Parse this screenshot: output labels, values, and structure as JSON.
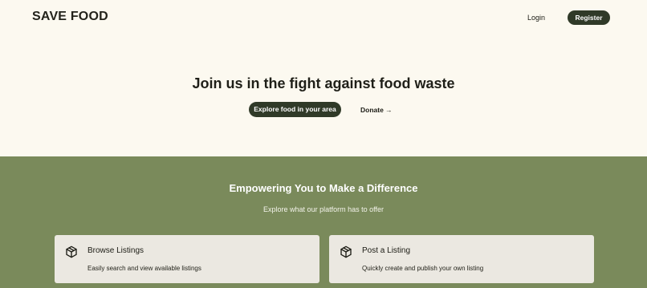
{
  "header": {
    "logo": "SAVE FOOD",
    "login_label": "Login",
    "register_label": "Register"
  },
  "hero": {
    "title": "Join us in the fight against food waste",
    "explore_label": "Explore food in your area",
    "donate_label": "Donate →"
  },
  "features": {
    "title": "Empowering You to Make a Difference",
    "subtitle": "Explore what our platform has to offer",
    "cards": [
      {
        "icon": "box-icon",
        "title": "Browse Listings",
        "description": "Easily search and view available listings"
      },
      {
        "icon": "box-icon",
        "title": "Post a Listing",
        "description": "Quickly create and publish your own listing"
      }
    ]
  },
  "colors": {
    "background": "#fcf9f0",
    "primary_button": "#303a28",
    "section_green": "#7a8a5b",
    "card_bg": "#ebe8e1"
  }
}
